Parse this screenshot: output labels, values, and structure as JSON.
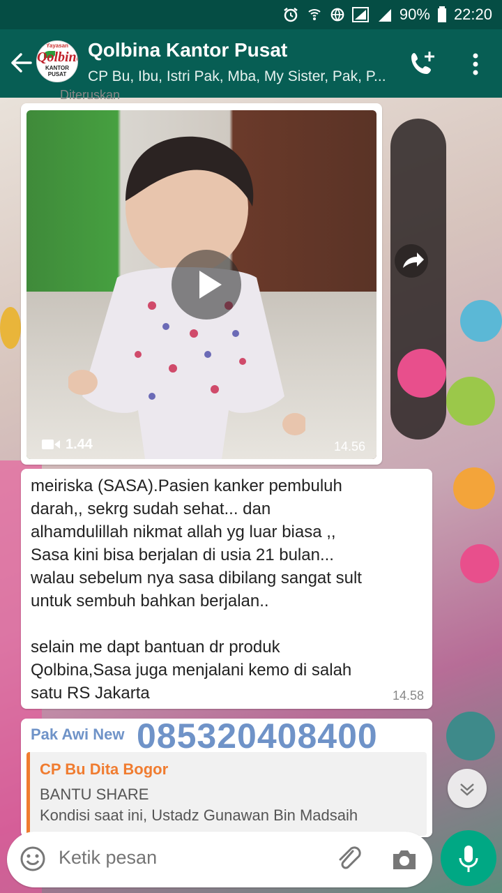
{
  "status_bar": {
    "battery": "90%",
    "time": "22:20"
  },
  "header": {
    "avatar": {
      "line1": "Yayasan",
      "line2": "Qolbina",
      "line3": "KANTOR PUSAT"
    },
    "title": "Qolbina Kantor Pusat",
    "subtitle": "CP Bu, Ibu, Istri Pak, Mba, My Sister, Pak, P..."
  },
  "messages": {
    "forwarded_label": "Diteruskan",
    "video": {
      "duration": "1.44",
      "time": "14.56"
    },
    "text": {
      "body": "meiriska (SASA).Pasien kanker pembuluh\ndarah,, sekrg sudah sehat... dan\nalhamdulillah nikmat allah yg luar biasa ,,\nSasa kini bisa berjalan di usia 21 bulan...\nwalau sebelum nya sasa dibilang sangat sult\nuntuk sembuh bahkan berjalan..\n\nselain me dapt bantuan dr produk\nQolbina,Sasa juga menjalani kemo di salah\nsatu RS Jakarta",
      "time": "14.58"
    },
    "reply": {
      "sender": "Pak Awi New",
      "phone": "085320408400",
      "quoted_name": "CP Bu Dita Bogor",
      "quoted_line1": "BANTU SHARE",
      "quoted_line2": "Kondisi saat ini, Ustadz Gunawan Bin Madsaih"
    }
  },
  "composer": {
    "placeholder": "Ketik pesan"
  },
  "colors": {
    "header": "#075e54",
    "status_bar": "#054d44",
    "send_button": "#00a884",
    "reply_sender": "#6f93c8",
    "quote_accent": "#f07c30"
  },
  "icons": [
    "alarm-icon",
    "hotspot-icon",
    "data-icon",
    "signal-icon",
    "battery-icon",
    "back-arrow-icon",
    "add-call-icon",
    "more-vert-icon",
    "play-icon",
    "video-camera-icon",
    "forward-icon",
    "chevron-down-icon",
    "emoji-icon",
    "attach-icon",
    "camera-icon",
    "mic-icon"
  ]
}
